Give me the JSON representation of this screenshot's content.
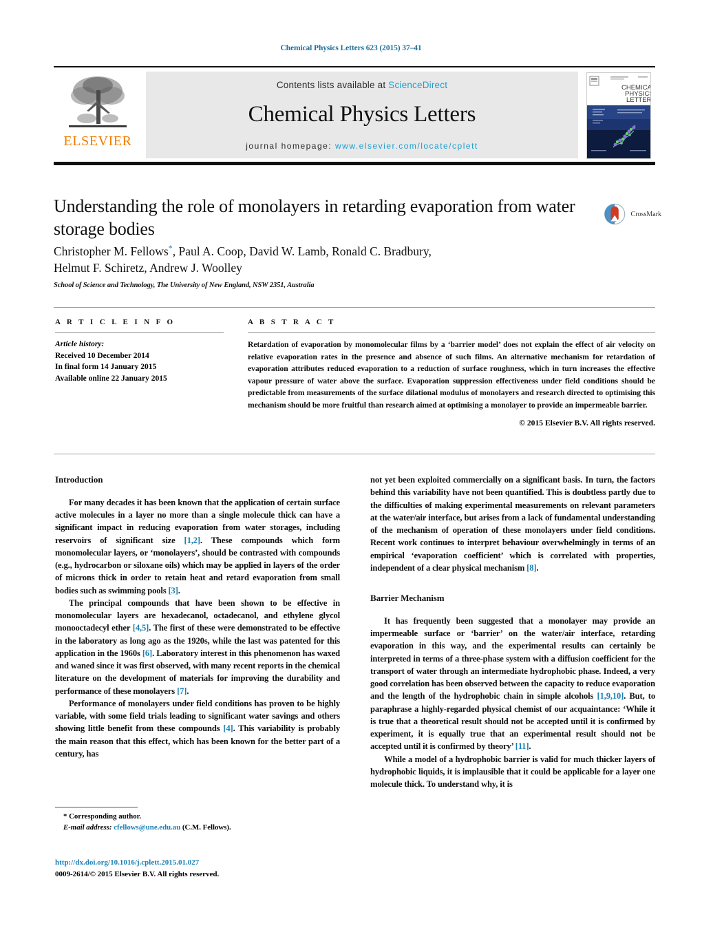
{
  "running_head": "Chemical Physics Letters 623 (2015) 37–41",
  "masthead": {
    "publisher_name": "ELSEVIER",
    "contents_prefix": "Contents lists available at",
    "sciencedirect": "ScienceDirect",
    "journal_name": "Chemical Physics Letters",
    "homepage_prefix": "journal homepage:",
    "homepage_url": "www.elsevier.com/locate/cplett",
    "cover_title_lines": [
      "CHEMICAL",
      "PHYSICS",
      "LETTERS"
    ],
    "colors": {
      "link": "#1b9fd0",
      "elsevier_orange": "#f07d00",
      "band_gray": "#e8e8e8"
    }
  },
  "article": {
    "title": "Understanding the role of monolayers in retarding evaporation from water storage bodies",
    "crossmark_label": "CrossMark",
    "authors_line1": "Christopher M. Fellows",
    "authors_line1_rest": ", Paul A. Coop, David W. Lamb, Ronald C. Bradbury,",
    "authors_line2": "Helmut F. Schiretz, Andrew J. Woolley",
    "corresponding_marker": "*",
    "affiliation": "School of Science and Technology, The University of New England, NSW 2351, Australia"
  },
  "info": {
    "heading": "A R T I C L E   I N F O",
    "history_label": "Article history:",
    "history": [
      "Received 10 December 2014",
      "In final form 14 January 2015",
      "Available online 22 January 2015"
    ]
  },
  "abstract": {
    "heading": "A B S T R A C T",
    "text": "Retardation of evaporation by monomolecular films by a ‘barrier model’ does not explain the effect of air velocity on relative evaporation rates in the presence and absence of such films. An alternative mechanism for retardation of evaporation attributes reduced evaporation to a reduction of surface roughness, which in turn increases the effective vapour pressure of water above the surface. Evaporation suppression effectiveness under field conditions should be predictable from measurements of the surface dilational modulus of monolayers and research directed to optimising this mechanism should be more fruitful than research aimed at optimising a monolayer to provide an impermeable barrier.",
    "copyright": "© 2015 Elsevier B.V. All rights reserved."
  },
  "body": {
    "left": {
      "heading": "Introduction",
      "paragraphs": [
        "For many decades it has been known that the application of certain surface active molecules in a layer no more than a single molecule thick can have a significant impact in reducing evaporation from water storages, including reservoirs of significant size [1,2]. These compounds which form monomolecular layers, or ‘monolayers’, should be contrasted with compounds (e.g., hydrocarbon or siloxane oils) which may be applied in layers of the order of microns thick in order to retain heat and retard evaporation from small bodies such as swimming pools [3].",
        "The principal compounds that have been shown to be effective in monomolecular layers are hexadecanol, octadecanol, and ethylene glycol monooctadecyl ether [4,5]. The first of these were demonstrated to be effective in the laboratory as long ago as the 1920s, while the last was patented for this application in the 1960s [6]. Laboratory interest in this phenomenon has waxed and waned since it was first observed, with many recent reports in the chemical literature on the development of materials for improving the durability and performance of these monolayers [7].",
        "Performance of monolayers under field conditions has proven to be highly variable, with some field trials leading to significant water savings and others showing little benefit from these compounds [4]. This variability is probably the main reason that this effect, which has been known for the better part of a century, has"
      ]
    },
    "right": {
      "continuation": "not yet been exploited commercially on a significant basis. In turn, the factors behind this variability have not been quantified. This is doubtless partly due to the difficulties of making experimental measurements on relevant parameters at the water/air interface, but arises from a lack of fundamental understanding of the mechanism of operation of these monolayers under field conditions. Recent work continues to interpret behaviour overwhelmingly in terms of an empirical ‘evaporation coefficient’ which is correlated with properties, independent of a clear physical mechanism [8].",
      "heading": "Barrier Mechanism",
      "paragraphs": [
        "It has frequently been suggested that a monolayer may provide an impermeable surface or ‘barrier’ on the water/air interface, retarding evaporation in this way, and the experimental results can certainly be interpreted in terms of a three-phase system with a diffusion coefficient for the transport of water through an intermediate hydrophobic phase. Indeed, a very good correlation has been observed between the capacity to reduce evaporation and the length of the hydrophobic chain in simple alcohols [1,9,10]. But, to paraphrase a highly-regarded physical chemist of our acquaintance: ‘While it is true that a theoretical result should not be accepted until it is confirmed by experiment, it is equally true that an experimental result should not be accepted until it is confirmed by theory’ [11].",
        "While a model of a hydrophobic barrier is valid for much thicker layers of hydrophobic liquids, it is implausible that it could be applicable for a layer one molecule thick. To understand why, it is"
      ]
    }
  },
  "footnote": {
    "corresponding_author": "* Corresponding author.",
    "email_label": "E-mail address:",
    "email": "cfellows@une.edu.au",
    "email_suffix": "(C.M. Fellows)."
  },
  "footer": {
    "doi": "http://dx.doi.org/10.1016/j.cplett.2015.01.027",
    "issn_line": "0009-2614/© 2015 Elsevier B.V. All rights reserved."
  }
}
